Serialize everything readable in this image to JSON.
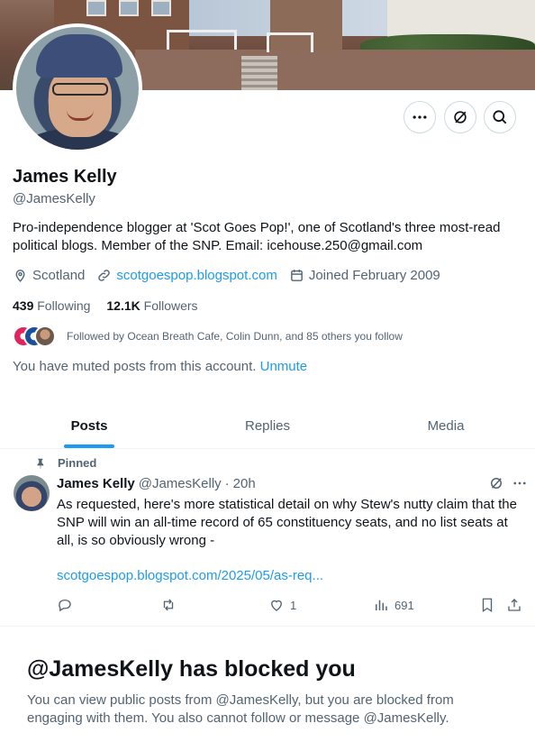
{
  "profile": {
    "name": "James Kelly",
    "handle": "@JamesKelly",
    "bio": "Pro-independence blogger at 'Scot Goes Pop!', one of Scotland's three most-read political blogs.  Member of the SNP.  Email: icehouse.250@gmail.com",
    "location": "Scotland",
    "website": "scotgoespop.blogspot.com",
    "joined": "Joined February 2009",
    "following_count": "439",
    "following_label": "Following",
    "followers_count": "12.1K",
    "followers_label": "Followers",
    "followed_by": "Followed by Ocean Breath Cafe, Colin Dunn, and 85 others you follow",
    "muted_text": "You have muted posts from this account.",
    "unmute_label": "Unmute"
  },
  "header_buttons": [
    {
      "icon": "more-icon"
    },
    {
      "icon": "grok-icon"
    },
    {
      "icon": "search-icon"
    }
  ],
  "tabs": [
    {
      "label": "Posts",
      "active": true
    },
    {
      "label": "Replies",
      "active": false
    },
    {
      "label": "Media",
      "active": false
    }
  ],
  "tweet": {
    "pinned_label": "Pinned",
    "author": "James Kelly",
    "handle": "@JamesKelly",
    "separator": "·",
    "time": "20h",
    "text": "As requested, here's more statistical detail on why Stew's nutty claim that the SNP will win an all-time record of 65 constituency seats, and no list seats at all, is so obviously wrong -",
    "link": "scotgoespop.blogspot.com/2025/05/as-req...",
    "replies": "",
    "retweets": "",
    "likes": "1",
    "views": "691"
  },
  "blocked": {
    "title": "@JamesKelly has blocked you",
    "text": "You can view public posts from @JamesKelly, but you are blocked from engaging with them. You also cannot follow or message @JamesKelly."
  },
  "colors": {
    "accent": "#1d9bf0",
    "secondary_text": "#536471",
    "primary_text": "#0f1419"
  }
}
